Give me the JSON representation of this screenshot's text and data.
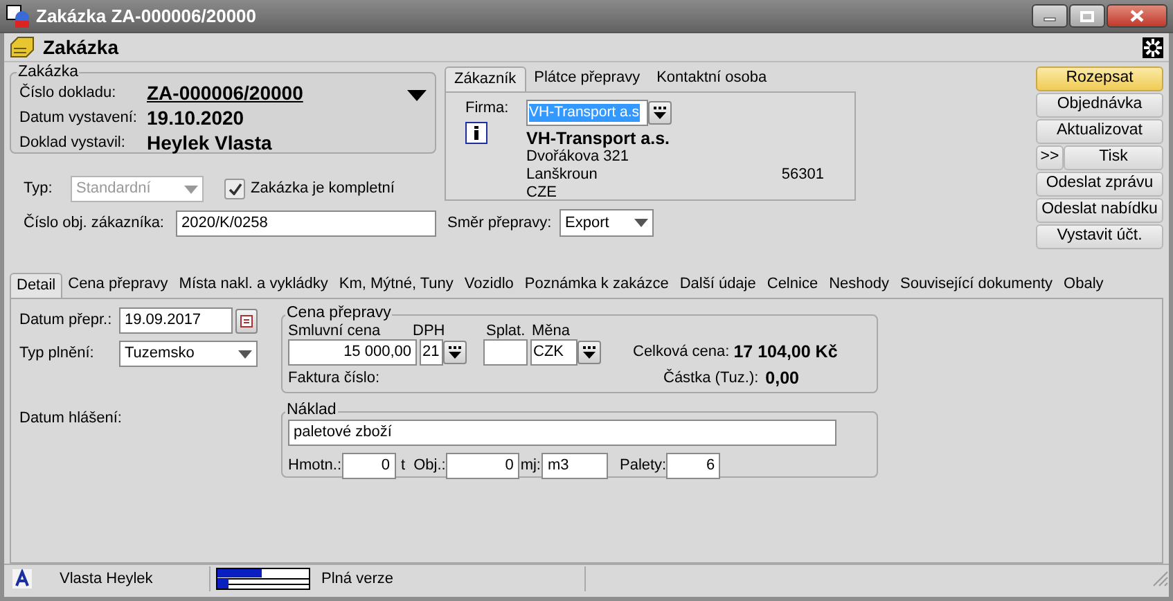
{
  "window": {
    "title": "Zakázka ZA-000006/20000"
  },
  "header": {
    "title": "Zakázka"
  },
  "order_group": {
    "legend": "Zakázka",
    "fields": [
      {
        "label": "Číslo dokladu:",
        "value": "ZA-000006/20000",
        "kind": "link"
      },
      {
        "label": "Datum vystavení:",
        "value": "19.10.2020",
        "kind": "text"
      },
      {
        "label": "Doklad vystavil:",
        "value": "Heylek Vlasta",
        "kind": "text"
      }
    ]
  },
  "type": {
    "label": "Typ:",
    "value": "Standardní",
    "disabled": true
  },
  "complete": {
    "label": "Zakázka je kompletní",
    "checked": true
  },
  "customer_order": {
    "label": "Číslo obj. zákazníka:",
    "value": "2020/K/0258"
  },
  "party_tabs": [
    {
      "label": "Zákazník",
      "selected": true
    },
    {
      "label": "Plátce přepravy",
      "selected": false
    },
    {
      "label": "Kontaktní osoba",
      "selected": false
    }
  ],
  "company": {
    "label": "Firma:",
    "value": "VH-Transport a.s",
    "name": "VH-Transport a.s.",
    "street": "Dvořákova 321",
    "city": "Lanškroun",
    "zip": "56301",
    "country": "CZE"
  },
  "direction": {
    "label": "Směr přepravy:",
    "value": "Export"
  },
  "actions": [
    {
      "label": "Rozepsat",
      "highlighted": true
    },
    {
      "label": "Objednávka",
      "highlighted": false
    },
    {
      "label": "Aktualizovat",
      "highlighted": false
    },
    {
      "label": "Tisk",
      "prefix": ">>",
      "highlighted": false
    },
    {
      "label": "Odeslat zprávu",
      "highlighted": false
    },
    {
      "label": "Odeslat nabídku",
      "highlighted": false
    },
    {
      "label": "Vystavit účt.",
      "highlighted": false
    }
  ],
  "detail_tabs": [
    {
      "label": "Detail",
      "selected": true
    },
    {
      "label": "Cena přepravy",
      "selected": false
    },
    {
      "label": "Místa nakl. a vykládky",
      "selected": false
    },
    {
      "label": "Km, Mýtné, Tuny",
      "selected": false
    },
    {
      "label": "Vozidlo",
      "selected": false
    },
    {
      "label": "Poznámka k zakázce",
      "selected": false
    },
    {
      "label": "Další údaje",
      "selected": false
    },
    {
      "label": "Celnice",
      "selected": false
    },
    {
      "label": "Neshody",
      "selected": false
    },
    {
      "label": "Související dokumenty",
      "selected": false
    },
    {
      "label": "Obaly",
      "selected": false
    }
  ],
  "detail": {
    "transport_date": {
      "label": "Datum přepr.:",
      "value": "19.09.2017"
    },
    "fulfillment": {
      "label": "Typ plnění:",
      "value": "Tuzemsko"
    },
    "report_date": {
      "label": "Datum hlášení:"
    },
    "price": {
      "legend": "Cena přepravy",
      "contract_price_label": "Smluvní cena",
      "contract_price": "15 000,00",
      "vat_label": "DPH",
      "vat": "21",
      "due_label": "Splat.",
      "currency_label": "Měna",
      "currency": "CZK",
      "invoice_label": "Faktura číslo:",
      "total_label": "Celková cena:",
      "total": "17 104,00 Kč",
      "domestic_label": "Částka (Tuz.):",
      "domestic": "0,00"
    },
    "cargo": {
      "legend": "Náklad",
      "description": "paletové zboží",
      "weight_label": "Hmotn.:",
      "weight": "0",
      "weight_unit": "t",
      "volume_label": "Obj.:",
      "volume": "0",
      "unit_label": "mj:",
      "unit": "m3",
      "pallets_label": "Palety:",
      "pallets": "6"
    }
  },
  "status_bar": {
    "user": "Vlasta Heylek",
    "edition": "Plná verze"
  }
}
